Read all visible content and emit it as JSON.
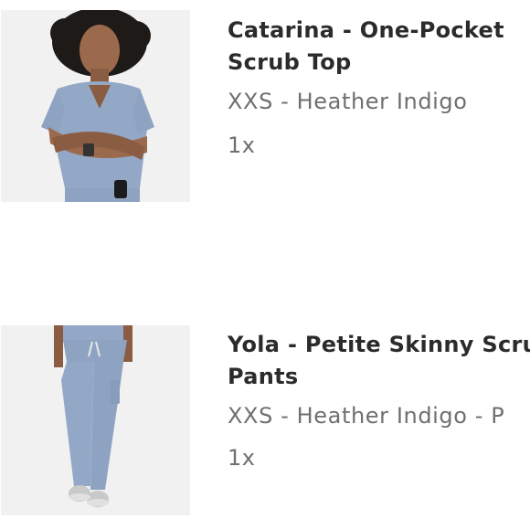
{
  "cart": {
    "items": [
      {
        "title_line1": "Catarina - One-Pocket",
        "title_line2": "Scrub Top",
        "variant": "XXS - Heather Indigo",
        "quantity": "1x",
        "image_icon": "scrub-top-product-photo"
      },
      {
        "title_line1": "Yola - Petite Skinny Scru",
        "title_line2": "Pants",
        "variant": "XXS - Heather Indigo - P",
        "quantity": "1x",
        "image_icon": "scrub-pants-product-photo"
      }
    ]
  },
  "colors": {
    "scrub": "#93a8c6",
    "photo_bg": "#f1f1f1",
    "title_text": "#2b2b2b",
    "meta_text": "#6f6f6f"
  }
}
